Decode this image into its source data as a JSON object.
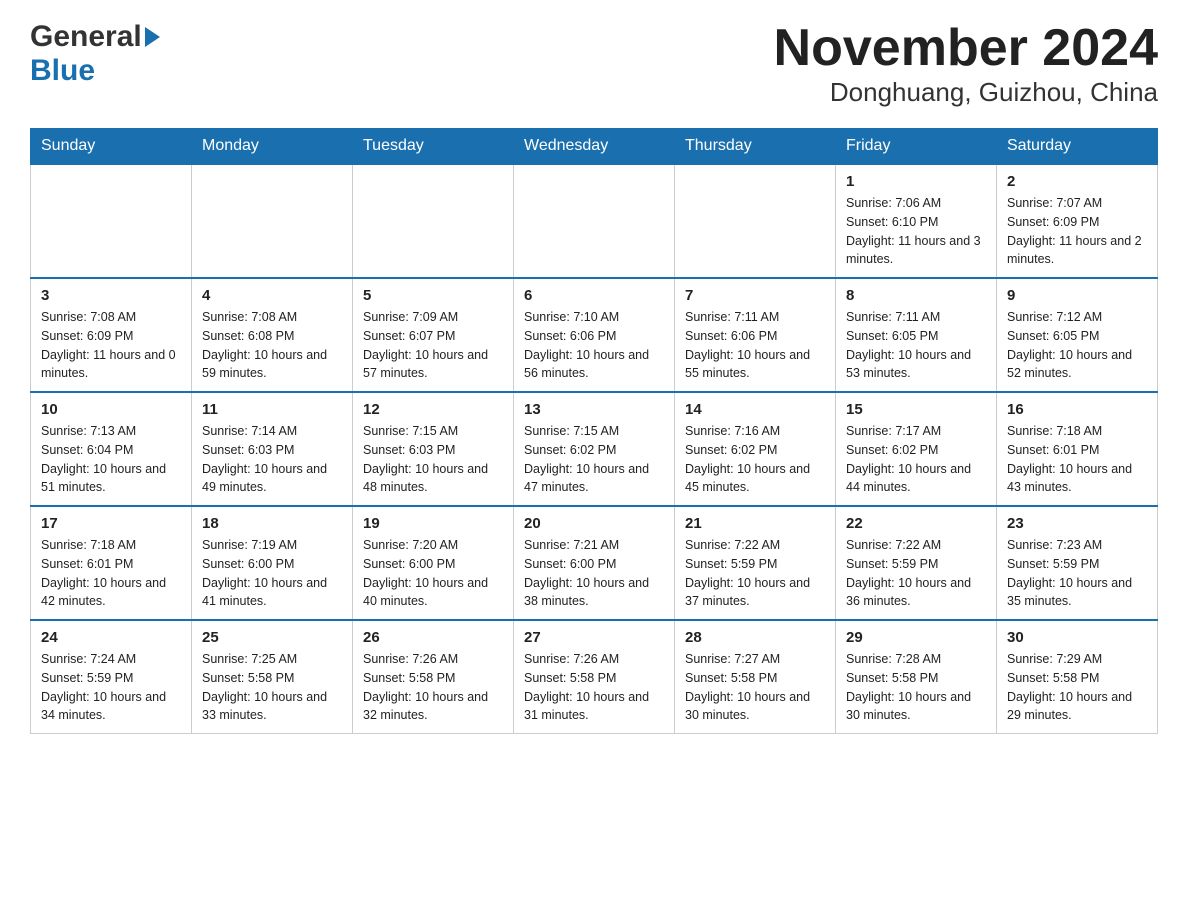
{
  "header": {
    "logo_general": "General",
    "logo_blue": "Blue",
    "title": "November 2024",
    "subtitle": "Donghuang, Guizhou, China"
  },
  "days_of_week": [
    "Sunday",
    "Monday",
    "Tuesday",
    "Wednesday",
    "Thursday",
    "Friday",
    "Saturday"
  ],
  "weeks": [
    [
      {
        "day": "",
        "info": ""
      },
      {
        "day": "",
        "info": ""
      },
      {
        "day": "",
        "info": ""
      },
      {
        "day": "",
        "info": ""
      },
      {
        "day": "",
        "info": ""
      },
      {
        "day": "1",
        "info": "Sunrise: 7:06 AM\nSunset: 6:10 PM\nDaylight: 11 hours and 3 minutes."
      },
      {
        "day": "2",
        "info": "Sunrise: 7:07 AM\nSunset: 6:09 PM\nDaylight: 11 hours and 2 minutes."
      }
    ],
    [
      {
        "day": "3",
        "info": "Sunrise: 7:08 AM\nSunset: 6:09 PM\nDaylight: 11 hours and 0 minutes."
      },
      {
        "day": "4",
        "info": "Sunrise: 7:08 AM\nSunset: 6:08 PM\nDaylight: 10 hours and 59 minutes."
      },
      {
        "day": "5",
        "info": "Sunrise: 7:09 AM\nSunset: 6:07 PM\nDaylight: 10 hours and 57 minutes."
      },
      {
        "day": "6",
        "info": "Sunrise: 7:10 AM\nSunset: 6:06 PM\nDaylight: 10 hours and 56 minutes."
      },
      {
        "day": "7",
        "info": "Sunrise: 7:11 AM\nSunset: 6:06 PM\nDaylight: 10 hours and 55 minutes."
      },
      {
        "day": "8",
        "info": "Sunrise: 7:11 AM\nSunset: 6:05 PM\nDaylight: 10 hours and 53 minutes."
      },
      {
        "day": "9",
        "info": "Sunrise: 7:12 AM\nSunset: 6:05 PM\nDaylight: 10 hours and 52 minutes."
      }
    ],
    [
      {
        "day": "10",
        "info": "Sunrise: 7:13 AM\nSunset: 6:04 PM\nDaylight: 10 hours and 51 minutes."
      },
      {
        "day": "11",
        "info": "Sunrise: 7:14 AM\nSunset: 6:03 PM\nDaylight: 10 hours and 49 minutes."
      },
      {
        "day": "12",
        "info": "Sunrise: 7:15 AM\nSunset: 6:03 PM\nDaylight: 10 hours and 48 minutes."
      },
      {
        "day": "13",
        "info": "Sunrise: 7:15 AM\nSunset: 6:02 PM\nDaylight: 10 hours and 47 minutes."
      },
      {
        "day": "14",
        "info": "Sunrise: 7:16 AM\nSunset: 6:02 PM\nDaylight: 10 hours and 45 minutes."
      },
      {
        "day": "15",
        "info": "Sunrise: 7:17 AM\nSunset: 6:02 PM\nDaylight: 10 hours and 44 minutes."
      },
      {
        "day": "16",
        "info": "Sunrise: 7:18 AM\nSunset: 6:01 PM\nDaylight: 10 hours and 43 minutes."
      }
    ],
    [
      {
        "day": "17",
        "info": "Sunrise: 7:18 AM\nSunset: 6:01 PM\nDaylight: 10 hours and 42 minutes."
      },
      {
        "day": "18",
        "info": "Sunrise: 7:19 AM\nSunset: 6:00 PM\nDaylight: 10 hours and 41 minutes."
      },
      {
        "day": "19",
        "info": "Sunrise: 7:20 AM\nSunset: 6:00 PM\nDaylight: 10 hours and 40 minutes."
      },
      {
        "day": "20",
        "info": "Sunrise: 7:21 AM\nSunset: 6:00 PM\nDaylight: 10 hours and 38 minutes."
      },
      {
        "day": "21",
        "info": "Sunrise: 7:22 AM\nSunset: 5:59 PM\nDaylight: 10 hours and 37 minutes."
      },
      {
        "day": "22",
        "info": "Sunrise: 7:22 AM\nSunset: 5:59 PM\nDaylight: 10 hours and 36 minutes."
      },
      {
        "day": "23",
        "info": "Sunrise: 7:23 AM\nSunset: 5:59 PM\nDaylight: 10 hours and 35 minutes."
      }
    ],
    [
      {
        "day": "24",
        "info": "Sunrise: 7:24 AM\nSunset: 5:59 PM\nDaylight: 10 hours and 34 minutes."
      },
      {
        "day": "25",
        "info": "Sunrise: 7:25 AM\nSunset: 5:58 PM\nDaylight: 10 hours and 33 minutes."
      },
      {
        "day": "26",
        "info": "Sunrise: 7:26 AM\nSunset: 5:58 PM\nDaylight: 10 hours and 32 minutes."
      },
      {
        "day": "27",
        "info": "Sunrise: 7:26 AM\nSunset: 5:58 PM\nDaylight: 10 hours and 31 minutes."
      },
      {
        "day": "28",
        "info": "Sunrise: 7:27 AM\nSunset: 5:58 PM\nDaylight: 10 hours and 30 minutes."
      },
      {
        "day": "29",
        "info": "Sunrise: 7:28 AM\nSunset: 5:58 PM\nDaylight: 10 hours and 30 minutes."
      },
      {
        "day": "30",
        "info": "Sunrise: 7:29 AM\nSunset: 5:58 PM\nDaylight: 10 hours and 29 minutes."
      }
    ]
  ]
}
